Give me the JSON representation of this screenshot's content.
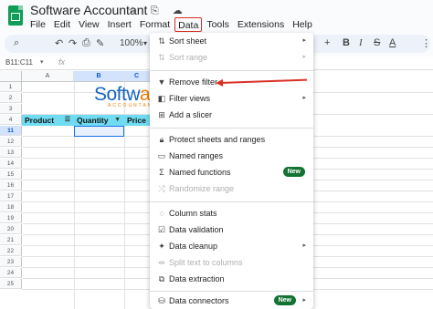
{
  "app": {
    "title": "Software Accountant",
    "title_icons": "☆ ⎘ ☁"
  },
  "menubar": [
    "File",
    "Edit",
    "View",
    "Insert",
    "Format",
    "Data",
    "Tools",
    "Extensions",
    "Help"
  ],
  "toolbar": {
    "zoom": "100%",
    "icons": [
      "search-icon",
      "undo-icon",
      "redo-icon",
      "print-icon",
      "paint-format-icon",
      "zoom-dropdown",
      "font-size-plus-icon",
      "bold-icon",
      "italic-icon",
      "strikethrough-icon",
      "text-color-icon",
      "more-icon"
    ]
  },
  "formula_bar": {
    "name_box": "B11:C11",
    "fx": "fx"
  },
  "columns": [
    "A",
    "B",
    "C"
  ],
  "rows": [
    "1",
    "2",
    "3",
    "4",
    "11",
    "12",
    "13",
    "14",
    "15",
    "16",
    "17",
    "18",
    "19",
    "20",
    "21",
    "22",
    "23",
    "24",
    "25"
  ],
  "brand": {
    "text_start": "Softw",
    "text_o": "a",
    "text_end": "re",
    "sub": "ACCOUNTANT"
  },
  "table_header": {
    "product": "Product",
    "quantity": "Quantity",
    "price": "Price"
  },
  "data_menu": {
    "items": [
      {
        "label": "Sort sheet",
        "icon": "sort-icon",
        "submenu": true,
        "disabled": false
      },
      {
        "label": "Sort range",
        "icon": "sort-range-icon",
        "submenu": true,
        "disabled": true
      },
      {
        "label": "Remove filter",
        "icon": "filter-icon",
        "submenu": false,
        "disabled": false
      },
      {
        "label": "Filter views",
        "icon": "filter-views-icon",
        "submenu": true,
        "disabled": false
      },
      {
        "label": "Add a slicer",
        "icon": "slicer-icon",
        "submenu": false,
        "disabled": false
      },
      {
        "label": "Protect sheets and ranges",
        "icon": "lock-icon",
        "submenu": false,
        "disabled": false
      },
      {
        "label": "Named ranges",
        "icon": "named-ranges-icon",
        "submenu": false,
        "disabled": false
      },
      {
        "label": "Named functions",
        "icon": "sigma-icon",
        "submenu": false,
        "disabled": false,
        "badge": "New"
      },
      {
        "label": "Randomize range",
        "icon": "randomize-icon",
        "submenu": false,
        "disabled": true
      },
      {
        "label": "Column stats",
        "icon": "lightbulb-icon",
        "submenu": false,
        "disabled": false
      },
      {
        "label": "Data validation",
        "icon": "validation-icon",
        "submenu": false,
        "disabled": false
      },
      {
        "label": "Data cleanup",
        "icon": "cleanup-icon",
        "submenu": true,
        "disabled": false
      },
      {
        "label": "Split text to columns",
        "icon": "split-icon",
        "submenu": false,
        "disabled": true
      },
      {
        "label": "Data extraction",
        "icon": "extraction-icon",
        "submenu": false,
        "disabled": false
      },
      {
        "label": "Data connectors",
        "icon": "database-icon",
        "submenu": true,
        "disabled": false,
        "badge": "New"
      }
    ]
  },
  "colors": {
    "accent": "#d93025",
    "header_fill": "#6fdcf1",
    "badge": "#137333",
    "selection": "#1a73e8"
  }
}
